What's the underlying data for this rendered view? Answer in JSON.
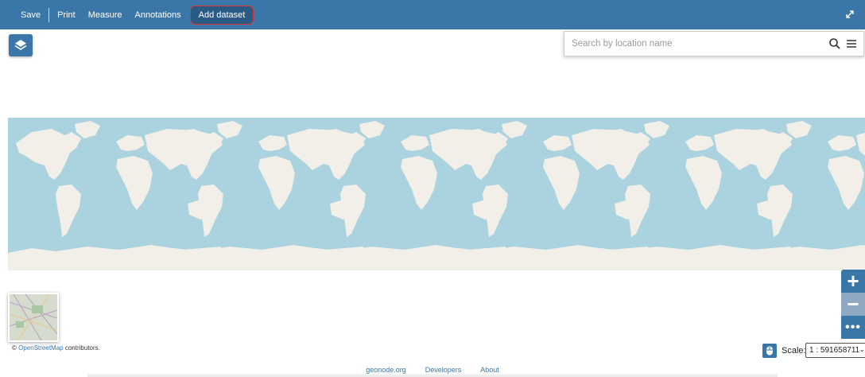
{
  "toolbar": {
    "save": "Save",
    "print": "Print",
    "measure": "Measure",
    "annotations": "Annotations",
    "add_dataset": "Add dataset",
    "fullscreen_icon": "expand-icon"
  },
  "search": {
    "placeholder": "Search by location name",
    "search_icon": "search-icon",
    "menu_icon": "menu-icon"
  },
  "map": {
    "ocean_color": "#aad3df",
    "land_color": "#f2efe9",
    "layers_icon": "layers-icon",
    "zoom_in": "+",
    "zoom_out": "−",
    "more": "•••"
  },
  "attribution": {
    "prefix": "©",
    "link": "OpenStreetMap",
    "suffix": "contributors."
  },
  "scale": {
    "label": "Scale:",
    "value": "1 : 591658711"
  },
  "footer": {
    "links": [
      "geonode.org",
      "Developers",
      "About"
    ]
  },
  "colors": {
    "toolbar": "#3a77a8",
    "active_highlight": "#e03030"
  }
}
